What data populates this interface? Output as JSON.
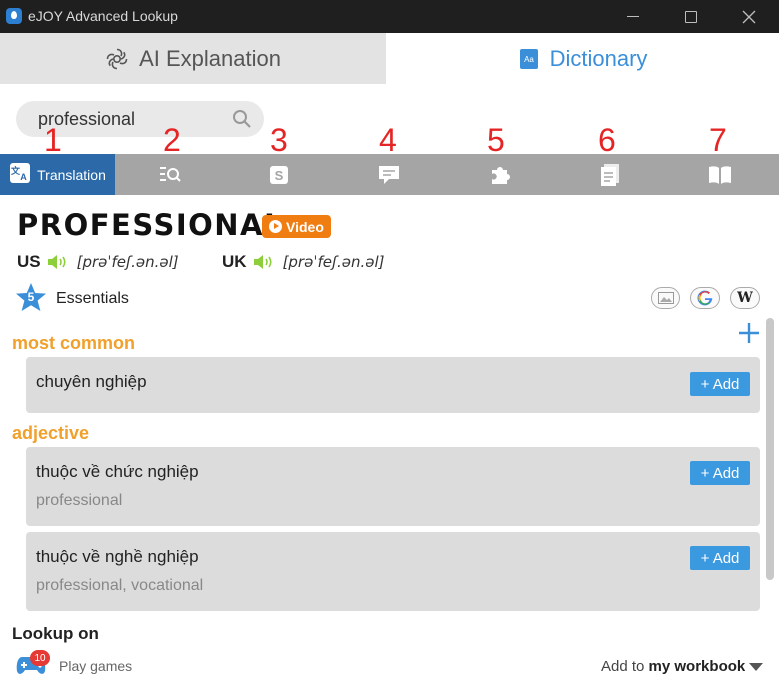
{
  "window": {
    "title": "eJOY Advanced Lookup"
  },
  "tabs": {
    "ai": "AI Explanation",
    "dictionary": "Dictionary"
  },
  "search": {
    "value": "professional"
  },
  "annotations": [
    "1",
    "2",
    "3",
    "4",
    "5",
    "6",
    "7"
  ],
  "toolbar": {
    "translation_label": "Translation",
    "icons": [
      "translate-icon",
      "search-list-icon",
      "s-icon",
      "comment-icon",
      "puzzle-icon",
      "document-icon",
      "book-icon"
    ]
  },
  "entry": {
    "word": "PROFESSIONAL",
    "video_label": "Video",
    "us_label": "US",
    "us_ipa": "[prəˈfeʃ.ən.əl]",
    "uk_label": "UK",
    "uk_ipa": "[prəˈfeʃ.ən.əl]",
    "essentials_count": "5",
    "essentials_label": "Essentials",
    "ext_w": "W"
  },
  "sections": [
    {
      "pos": "most common",
      "meanings": [
        {
          "text": "chuyên nghiệp",
          "sub": ""
        }
      ]
    },
    {
      "pos": "adjective",
      "meanings": [
        {
          "text": "thuộc về chức nghiệp",
          "sub": "professional"
        },
        {
          "text": "thuộc về nghề nghiệp",
          "sub": "professional, vocational"
        }
      ]
    }
  ],
  "add_label": "+ Add",
  "footer": {
    "lookup_on": "Lookup on",
    "games_count": "10",
    "games_label": "Play games",
    "add_to_prefix": "Add to",
    "workbook": "my workbook"
  },
  "colors": {
    "accent": "#3b8fd9",
    "pos": "#f0a02b",
    "video": "#f07d12",
    "active_tool": "#2b69a8",
    "annotation": "#e52525"
  }
}
